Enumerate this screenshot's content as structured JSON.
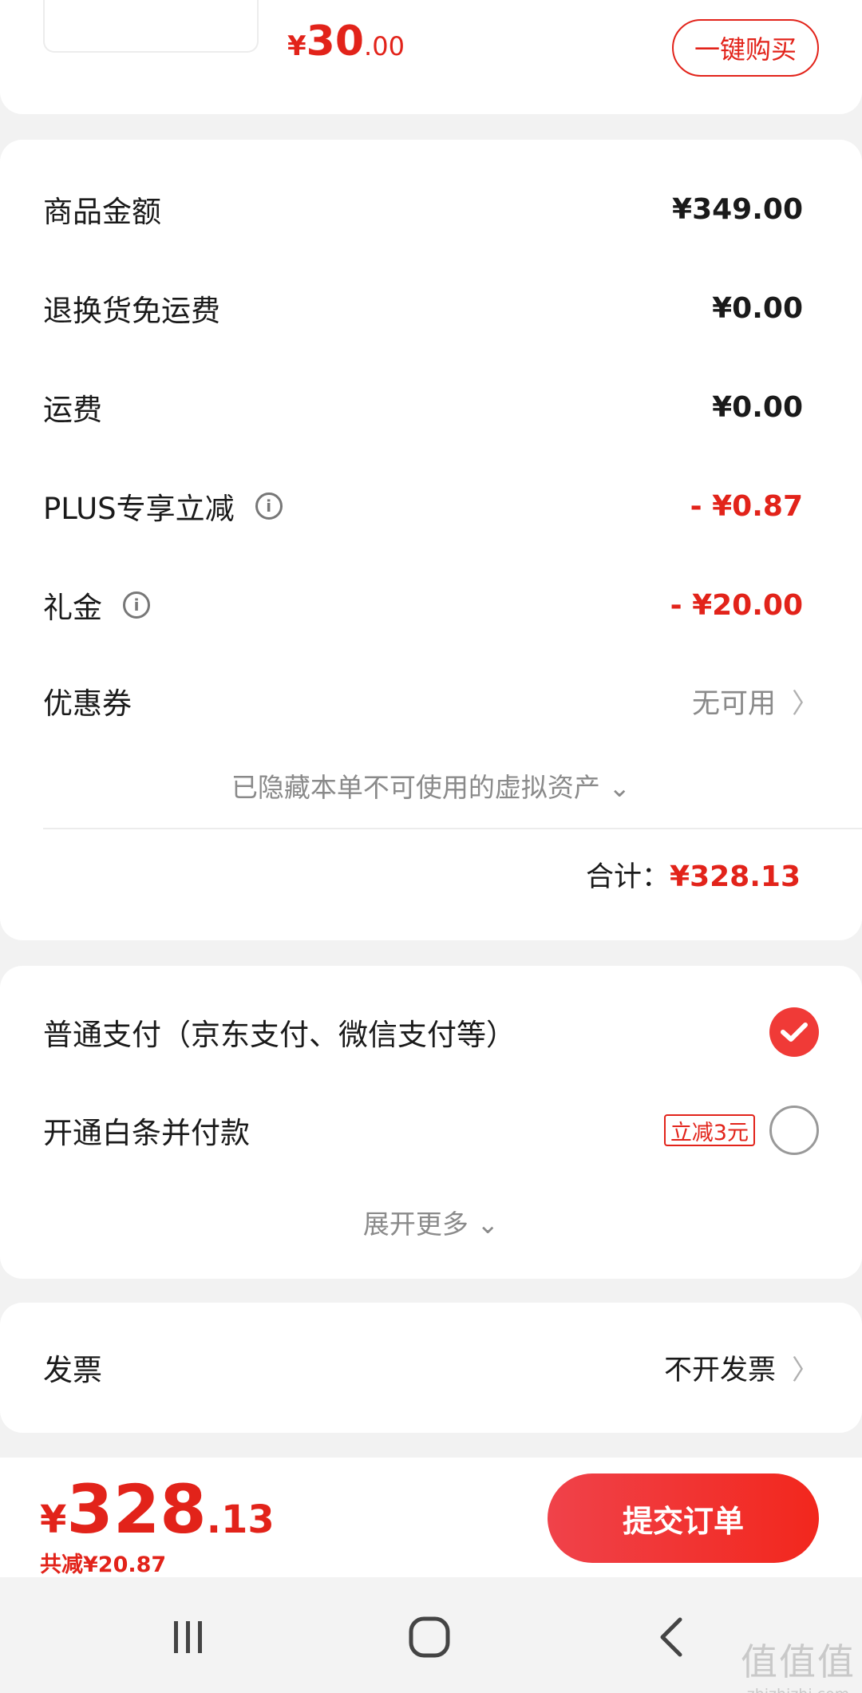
{
  "product": {
    "price_yen": "¥",
    "price_int": "30",
    "price_dec": ".00",
    "buy_now_label": "一键购买"
  },
  "summary": {
    "rows": [
      {
        "label": "商品金额",
        "value": "¥349.00"
      },
      {
        "label": "退换货免运费",
        "value": "¥0.00"
      },
      {
        "label": "运费",
        "value": "¥0.00"
      },
      {
        "label": "PLUS专享立减",
        "value": "- ¥0.87"
      },
      {
        "label": "礼金",
        "value": "- ¥20.00"
      }
    ],
    "coupon_label": "优惠券",
    "coupon_value": "无可用",
    "hidden_note": "已隐藏本单不可使用的虚拟资产",
    "total_label": "合计：",
    "total_value": "¥328.13"
  },
  "payment": {
    "options": [
      {
        "label": "普通支付（京东支付、微信支付等）",
        "selected": true
      },
      {
        "label": "开通白条并付款",
        "selected": false,
        "promo": "立减3元"
      }
    ],
    "expand_label": "展开更多"
  },
  "invoice": {
    "label": "发票",
    "value": "不开发票"
  },
  "bottom_bar": {
    "price_yen": "¥",
    "price_int": "328",
    "price_dec": ".13",
    "saved_text": "共减¥20.87",
    "submit_label": "提交订单"
  },
  "watermark": {
    "glyphs": "值值值",
    "domain": "zhizhizhi.com"
  },
  "colors": {
    "accent_red": "#e2231a",
    "muted_gray": "#8a8a8a",
    "background": "#f2f2f2"
  }
}
